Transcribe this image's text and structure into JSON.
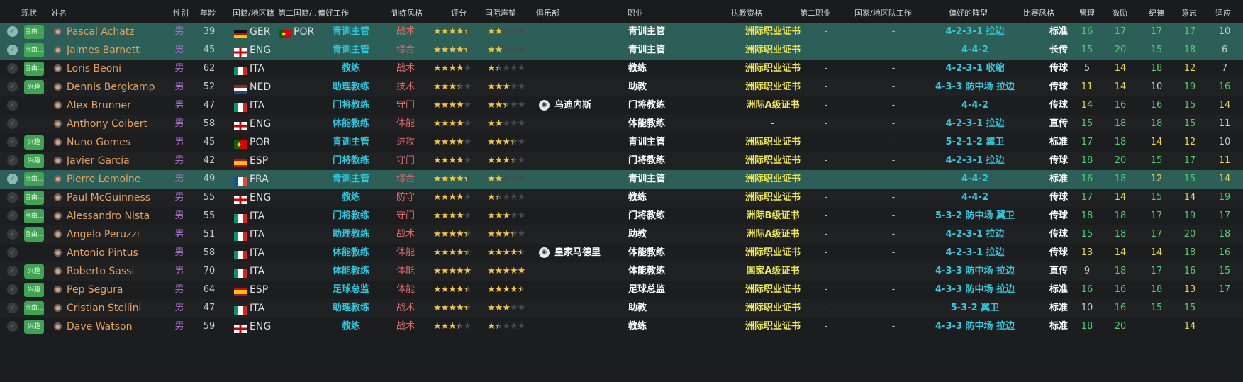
{
  "headers": {
    "status": "现状",
    "name": "姓名",
    "gender": "性别",
    "age": "年龄",
    "nationality": "国籍/地区籍",
    "second_nationality": "第二国籍/...",
    "preferred_job": "偏好工作",
    "training_style": "训练风格",
    "rating": "评分",
    "reputation": "国际声望",
    "club": "俱乐部",
    "occupation": "职业",
    "license": "执教资格",
    "second_occupation": "第二职业",
    "national_team_job": "国家/地区队工作",
    "preferred_formation": "偏好的阵型",
    "match_style": "比赛风格",
    "management": "管理",
    "motivation": "激励",
    "discipline": "纪律",
    "determination": "意志",
    "adaptability": "适应"
  },
  "check_icon": "check-circle-icon",
  "person_icon": "person-icon",
  "rows": [
    {
      "selected": true,
      "status": "自由...",
      "name": "Pascal Achatz",
      "gender": "男",
      "age": "39",
      "nat_flag": "GER",
      "nat": "GER",
      "nat2_flag": "POR",
      "nat2": "POR",
      "job": "青训主管",
      "style": "战术",
      "rating": 4.5,
      "reputation": 2,
      "club": "",
      "club_icon": "",
      "occupation": "青训主管",
      "license": "洲际职业证书",
      "second_occ": "-",
      "nt_job": "-",
      "formation": "4-2-3-1 拉边",
      "match_style": "标准",
      "management": "16",
      "motivation": "17",
      "discipline": "17",
      "determination": "17",
      "adaptability": "10"
    },
    {
      "selected": true,
      "status": "自由...",
      "name": "Jaimes Barnett",
      "gender": "男",
      "age": "45",
      "nat_flag": "ENG",
      "nat": "ENG",
      "nat2_flag": "",
      "nat2": "",
      "job": "青训主管",
      "style": "综合",
      "rating": 4.5,
      "reputation": 2,
      "club": "",
      "club_icon": "",
      "occupation": "青训主管",
      "license": "洲际职业证书",
      "second_occ": "-",
      "nt_job": "-",
      "formation": "4-4-2",
      "match_style": "长传",
      "management": "15",
      "motivation": "20",
      "discipline": "15",
      "determination": "18",
      "adaptability": "6"
    },
    {
      "selected": false,
      "status": "自由...",
      "name": "Loris Beoni",
      "gender": "男",
      "age": "62",
      "nat_flag": "ITA",
      "nat": "ITA",
      "nat2_flag": "",
      "nat2": "",
      "job": "教练",
      "style": "战术",
      "rating": 4,
      "reputation": 1.5,
      "club": "",
      "club_icon": "",
      "occupation": "教练",
      "license": "洲际职业证书",
      "second_occ": "-",
      "nt_job": "-",
      "formation": "4-2-3-1 收缩",
      "match_style": "传球",
      "management": "5",
      "motivation": "14",
      "discipline": "18",
      "determination": "12",
      "adaptability": "7"
    },
    {
      "selected": false,
      "status": "兴趣",
      "name": "Dennis Bergkamp",
      "gender": "男",
      "age": "52",
      "nat_flag": "NED",
      "nat": "NED",
      "nat2_flag": "",
      "nat2": "",
      "job": "助理教练",
      "style": "技术",
      "rating": 3.5,
      "reputation": 3,
      "club": "",
      "club_icon": "",
      "occupation": "助教",
      "license": "洲际职业证书",
      "second_occ": "-",
      "nt_job": "-",
      "formation": "4-3-3 防中场 拉边",
      "match_style": "传球",
      "management": "11",
      "motivation": "14",
      "discipline": "10",
      "determination": "19",
      "adaptability": "16"
    },
    {
      "selected": false,
      "status": "",
      "name": "Alex Brunner",
      "gender": "男",
      "age": "47",
      "nat_flag": "ITA",
      "nat": "ITA",
      "nat2_flag": "",
      "nat2": "",
      "job": "门将教练",
      "style": "守门",
      "rating": 4,
      "reputation": 2.5,
      "club": "乌迪内斯",
      "club_icon": "udinese-crest-icon",
      "occupation": "门将教练",
      "license": "洲际A级证书",
      "second_occ": "-",
      "nt_job": "-",
      "formation": "4-4-2",
      "match_style": "传球",
      "management": "14",
      "motivation": "16",
      "discipline": "16",
      "determination": "15",
      "adaptability": "14"
    },
    {
      "selected": false,
      "status": "",
      "name": "Anthony Colbert",
      "gender": "男",
      "age": "58",
      "nat_flag": "ENG",
      "nat": "ENG",
      "nat2_flag": "",
      "nat2": "",
      "job": "体能教练",
      "style": "体能",
      "rating": 4,
      "reputation": 2,
      "club": "",
      "club_icon": "",
      "occupation": "体能教练",
      "license": "-",
      "second_occ": "-",
      "nt_job": "-",
      "formation": "4-2-3-1 拉边",
      "match_style": "直传",
      "management": "15",
      "motivation": "18",
      "discipline": "18",
      "determination": "15",
      "adaptability": "11"
    },
    {
      "selected": false,
      "status": "兴趣",
      "name": "Nuno Gomes",
      "gender": "男",
      "age": "45",
      "nat_flag": "POR",
      "nat": "POR",
      "nat2_flag": "",
      "nat2": "",
      "job": "青训主管",
      "style": "进攻",
      "rating": 4,
      "reputation": 3.5,
      "club": "",
      "club_icon": "",
      "occupation": "青训主管",
      "license": "洲际职业证书",
      "second_occ": "-",
      "nt_job": "-",
      "formation": "5-2-1-2 翼卫",
      "match_style": "标准",
      "management": "17",
      "motivation": "18",
      "discipline": "14",
      "determination": "12",
      "adaptability": "10"
    },
    {
      "selected": false,
      "status": "兴趣",
      "name": "Javier García",
      "gender": "男",
      "age": "42",
      "nat_flag": "ESP",
      "nat": "ESP",
      "nat2_flag": "",
      "nat2": "",
      "job": "门将教练",
      "style": "守门",
      "rating": 4,
      "reputation": 3.5,
      "club": "",
      "club_icon": "",
      "occupation": "门将教练",
      "license": "洲际职业证书",
      "second_occ": "-",
      "nt_job": "-",
      "formation": "4-2-3-1 拉边",
      "match_style": "传球",
      "management": "18",
      "motivation": "20",
      "discipline": "15",
      "determination": "17",
      "adaptability": "11"
    },
    {
      "selected": true,
      "status": "自由...",
      "name": "Pierre Lemoine",
      "gender": "男",
      "age": "49",
      "nat_flag": "FRA",
      "nat": "FRA",
      "nat2_flag": "",
      "nat2": "",
      "job": "青训主管",
      "style": "综合",
      "rating": 4.5,
      "reputation": 2,
      "club": "",
      "club_icon": "",
      "occupation": "青训主管",
      "license": "洲际职业证书",
      "second_occ": "-",
      "nt_job": "-",
      "formation": "4-4-2",
      "match_style": "标准",
      "management": "16",
      "motivation": "18",
      "discipline": "12",
      "determination": "15",
      "adaptability": "14"
    },
    {
      "selected": false,
      "status": "自由...",
      "name": "Paul McGuinness",
      "gender": "男",
      "age": "55",
      "nat_flag": "ENG",
      "nat": "ENG",
      "nat2_flag": "",
      "nat2": "",
      "job": "教练",
      "style": "防守",
      "rating": 4,
      "reputation": 1.5,
      "club": "",
      "club_icon": "",
      "occupation": "教练",
      "license": "洲际职业证书",
      "second_occ": "-",
      "nt_job": "-",
      "formation": "4-4-2",
      "match_style": "传球",
      "management": "17",
      "motivation": "14",
      "discipline": "15",
      "determination": "14",
      "adaptability": "19"
    },
    {
      "selected": false,
      "status": "自由...",
      "name": "Alessandro Nista",
      "gender": "男",
      "age": "55",
      "nat_flag": "ITA",
      "nat": "ITA",
      "nat2_flag": "",
      "nat2": "",
      "job": "门将教练",
      "style": "守门",
      "rating": 4,
      "reputation": 3,
      "club": "",
      "club_icon": "",
      "occupation": "门将教练",
      "license": "洲际B级证书",
      "second_occ": "-",
      "nt_job": "-",
      "formation": "5-3-2 防中场 翼卫",
      "match_style": "传球",
      "management": "18",
      "motivation": "18",
      "discipline": "17",
      "determination": "19",
      "adaptability": "17"
    },
    {
      "selected": false,
      "status": "自由...",
      "name": "Angelo Peruzzi",
      "gender": "男",
      "age": "51",
      "nat_flag": "ITA",
      "nat": "ITA",
      "nat2_flag": "",
      "nat2": "",
      "job": "助理教练",
      "style": "战术",
      "rating": 4.5,
      "reputation": 3.5,
      "club": "",
      "club_icon": "",
      "occupation": "助教",
      "license": "洲际A级证书",
      "second_occ": "-",
      "nt_job": "-",
      "formation": "4-2-3-1 拉边",
      "match_style": "传球",
      "management": "15",
      "motivation": "18",
      "discipline": "17",
      "determination": "20",
      "adaptability": "18"
    },
    {
      "selected": false,
      "status": "",
      "name": "Antonio Pintus",
      "gender": "男",
      "age": "58",
      "nat_flag": "ITA",
      "nat": "ITA",
      "nat2_flag": "",
      "nat2": "",
      "job": "体能教练",
      "style": "体能",
      "rating": 4.5,
      "reputation": 4.5,
      "club": "皇家马德里",
      "club_icon": "real-madrid-crest-icon",
      "occupation": "体能教练",
      "license": "洲际职业证书",
      "second_occ": "-",
      "nt_job": "-",
      "formation": "4-2-3-1 拉边",
      "match_style": "传球",
      "management": "13",
      "motivation": "14",
      "discipline": "14",
      "determination": "18",
      "adaptability": "16"
    },
    {
      "selected": false,
      "status": "兴趣",
      "name": "Roberto Sassi",
      "gender": "男",
      "age": "70",
      "nat_flag": "ITA",
      "nat": "ITA",
      "nat2_flag": "",
      "nat2": "",
      "job": "体能教练",
      "style": "体能",
      "rating": 5,
      "reputation": 5,
      "club": "",
      "club_icon": "",
      "occupation": "体能教练",
      "license": "国家A级证书",
      "second_occ": "-",
      "nt_job": "-",
      "formation": "4-3-3 防中场 拉边",
      "match_style": "直传",
      "management": "9",
      "motivation": "18",
      "discipline": "17",
      "determination": "16",
      "adaptability": "15"
    },
    {
      "selected": false,
      "status": "兴趣",
      "name": "Pep Segura",
      "gender": "男",
      "age": "64",
      "nat_flag": "ESP",
      "nat": "ESP",
      "nat2_flag": "",
      "nat2": "",
      "job": "足球总监",
      "style": "体能",
      "rating": 4.5,
      "reputation": 4.5,
      "club": "",
      "club_icon": "",
      "occupation": "足球总监",
      "license": "洲际职业证书",
      "second_occ": "-",
      "nt_job": "-",
      "formation": "4-3-3 防中场 拉边",
      "match_style": "标准",
      "management": "16",
      "motivation": "16",
      "discipline": "18",
      "determination": "13",
      "adaptability": "17"
    },
    {
      "selected": false,
      "status": "自由...",
      "name": "Cristian Stellini",
      "gender": "男",
      "age": "47",
      "nat_flag": "ITA",
      "nat": "ITA",
      "nat2_flag": "",
      "nat2": "",
      "job": "助理教练",
      "style": "战术",
      "rating": 4.5,
      "reputation": 3,
      "club": "",
      "club_icon": "",
      "occupation": "助教",
      "license": "洲际职业证书",
      "second_occ": "-",
      "nt_job": "-",
      "formation": "5-3-2 翼卫",
      "match_style": "标准",
      "management": "10",
      "motivation": "16",
      "discipline": "15",
      "determination": "15",
      "adaptability": ""
    },
    {
      "selected": false,
      "status": "兴趣",
      "name": "Dave Watson",
      "gender": "男",
      "age": "59",
      "nat_flag": "ENG",
      "nat": "ENG",
      "nat2_flag": "",
      "nat2": "",
      "job": "教练",
      "style": "战术",
      "rating": 3.5,
      "reputation": 1.5,
      "club": "",
      "club_icon": "",
      "occupation": "教练",
      "license": "洲际职业证书",
      "second_occ": "-",
      "nt_job": "-",
      "formation": "4-3-3 防中场 拉边",
      "match_style": "标准",
      "management": "18",
      "motivation": "20",
      "discipline": "",
      "determination": "14",
      "adaptability": ""
    }
  ],
  "colors": {
    "background": "#1c1d1f",
    "selected_row": "#2d5f59",
    "name": "#e5a25b",
    "job": "#27c8e0",
    "style": "#e06b6b",
    "license": "#f0e84b",
    "star_on": "#f3c63d",
    "attr_high": "#4ad36b",
    "attr_mid": "#e7d84a",
    "attr_low": "#c9c9c9"
  }
}
